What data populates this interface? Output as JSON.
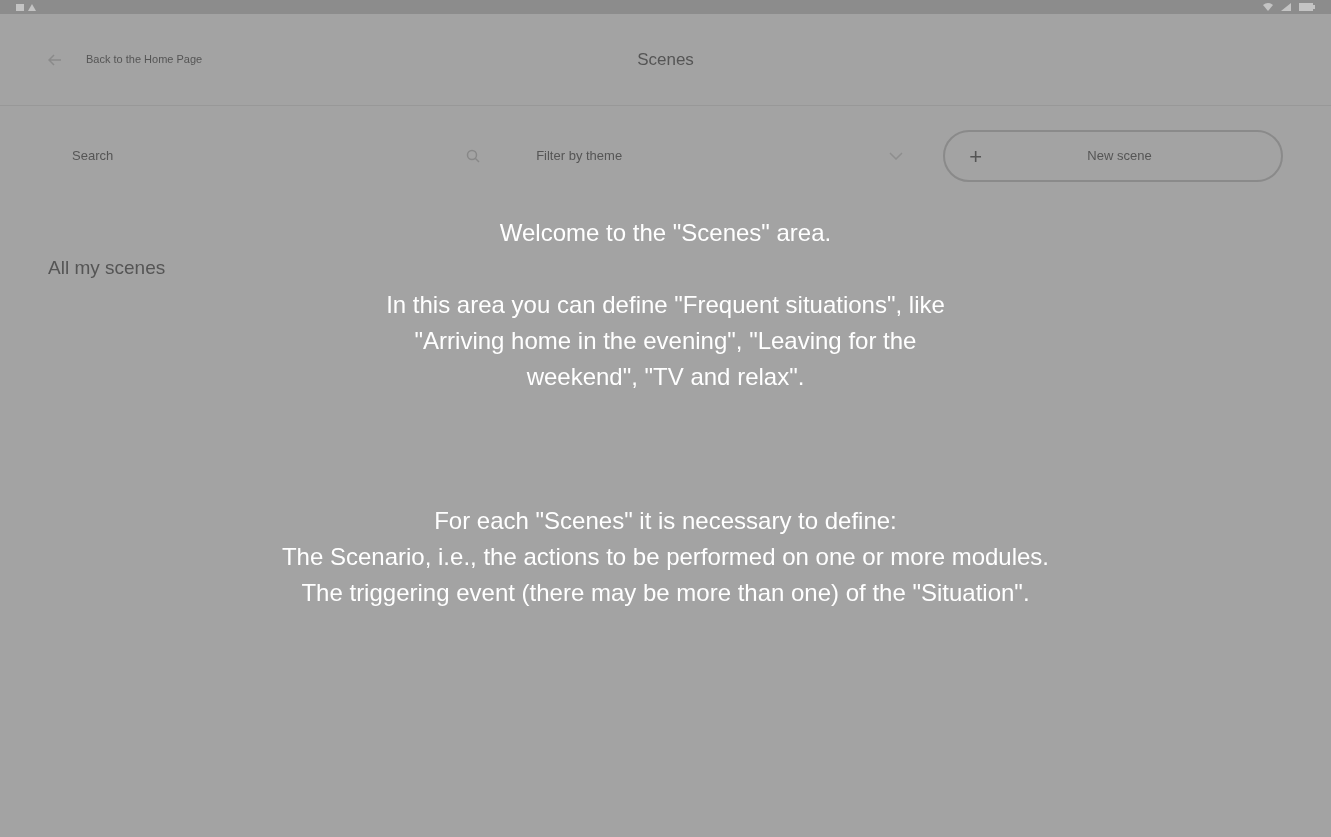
{
  "header": {
    "back_label": "Back to the Home Page",
    "title": "Scenes"
  },
  "toolbar": {
    "search_placeholder": "Search",
    "filter_placeholder": "Filter by theme",
    "new_button": "+",
    "new_label": "New scene"
  },
  "section_title": "All my scenes",
  "overlay": {
    "welcome": "Welcome to the \"Scenes\" area.",
    "intro": "In this area you can define \"Frequent situations\", like \"Arriving home in the evening\", \"Leaving for the weekend\", \"TV and relax\".",
    "lines": [
      "For each \"Scenes\" it is necessary to define:",
      "The Scenario, i.e., the actions to be performed on one or more modules.",
      "The triggering event (there may be more than one) of the \"Situation\"."
    ]
  }
}
